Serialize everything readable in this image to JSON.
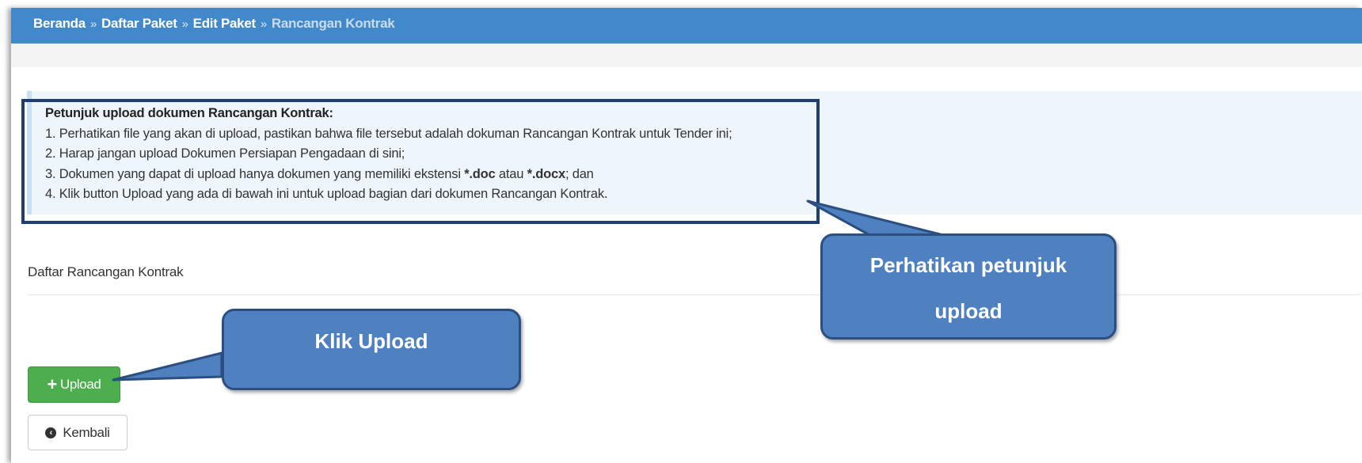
{
  "breadcrumb": {
    "items": [
      "Beranda",
      "Daftar Paket",
      "Edit Paket",
      "Rancangan Kontrak"
    ],
    "separator": "»"
  },
  "instructions": {
    "title": "Petunjuk upload dokumen Rancangan Kontrak:",
    "line1": "1. Perhatikan file yang akan di upload, pastikan bahwa file tersebut adalah dokuman Rancangan Kontrak untuk Tender ini;",
    "line2": "2. Harap jangan upload Dokumen Persiapan Pengadaan di sini;",
    "line3_pre": "3. Dokumen yang dapat di upload hanya dokumen yang memiliki ekstensi ",
    "line3_ext1": "*.doc",
    "line3_mid": " atau ",
    "line3_ext2": "*.docx",
    "line3_post": "; dan",
    "line4": "4. Klik button Upload yang ada di bawah ini untuk upload bagian dari dokumen Rancangan Kontrak."
  },
  "section": {
    "title": "Daftar Rancangan Kontrak"
  },
  "buttons": {
    "upload_icon": "+",
    "upload_label": "Upload",
    "back_icon": "circle-arrow-left-icon",
    "back_label": "Kembali"
  },
  "callouts": {
    "upload": "Klik Upload",
    "petunjuk_line1": "Perhatikan petunjuk",
    "petunjuk_line2": "upload"
  },
  "colors": {
    "topbar": "#4189cb",
    "upload_button": "#4cae4c",
    "callout_fill": "#4f80bf",
    "highlight_border": "#1f3f73"
  }
}
